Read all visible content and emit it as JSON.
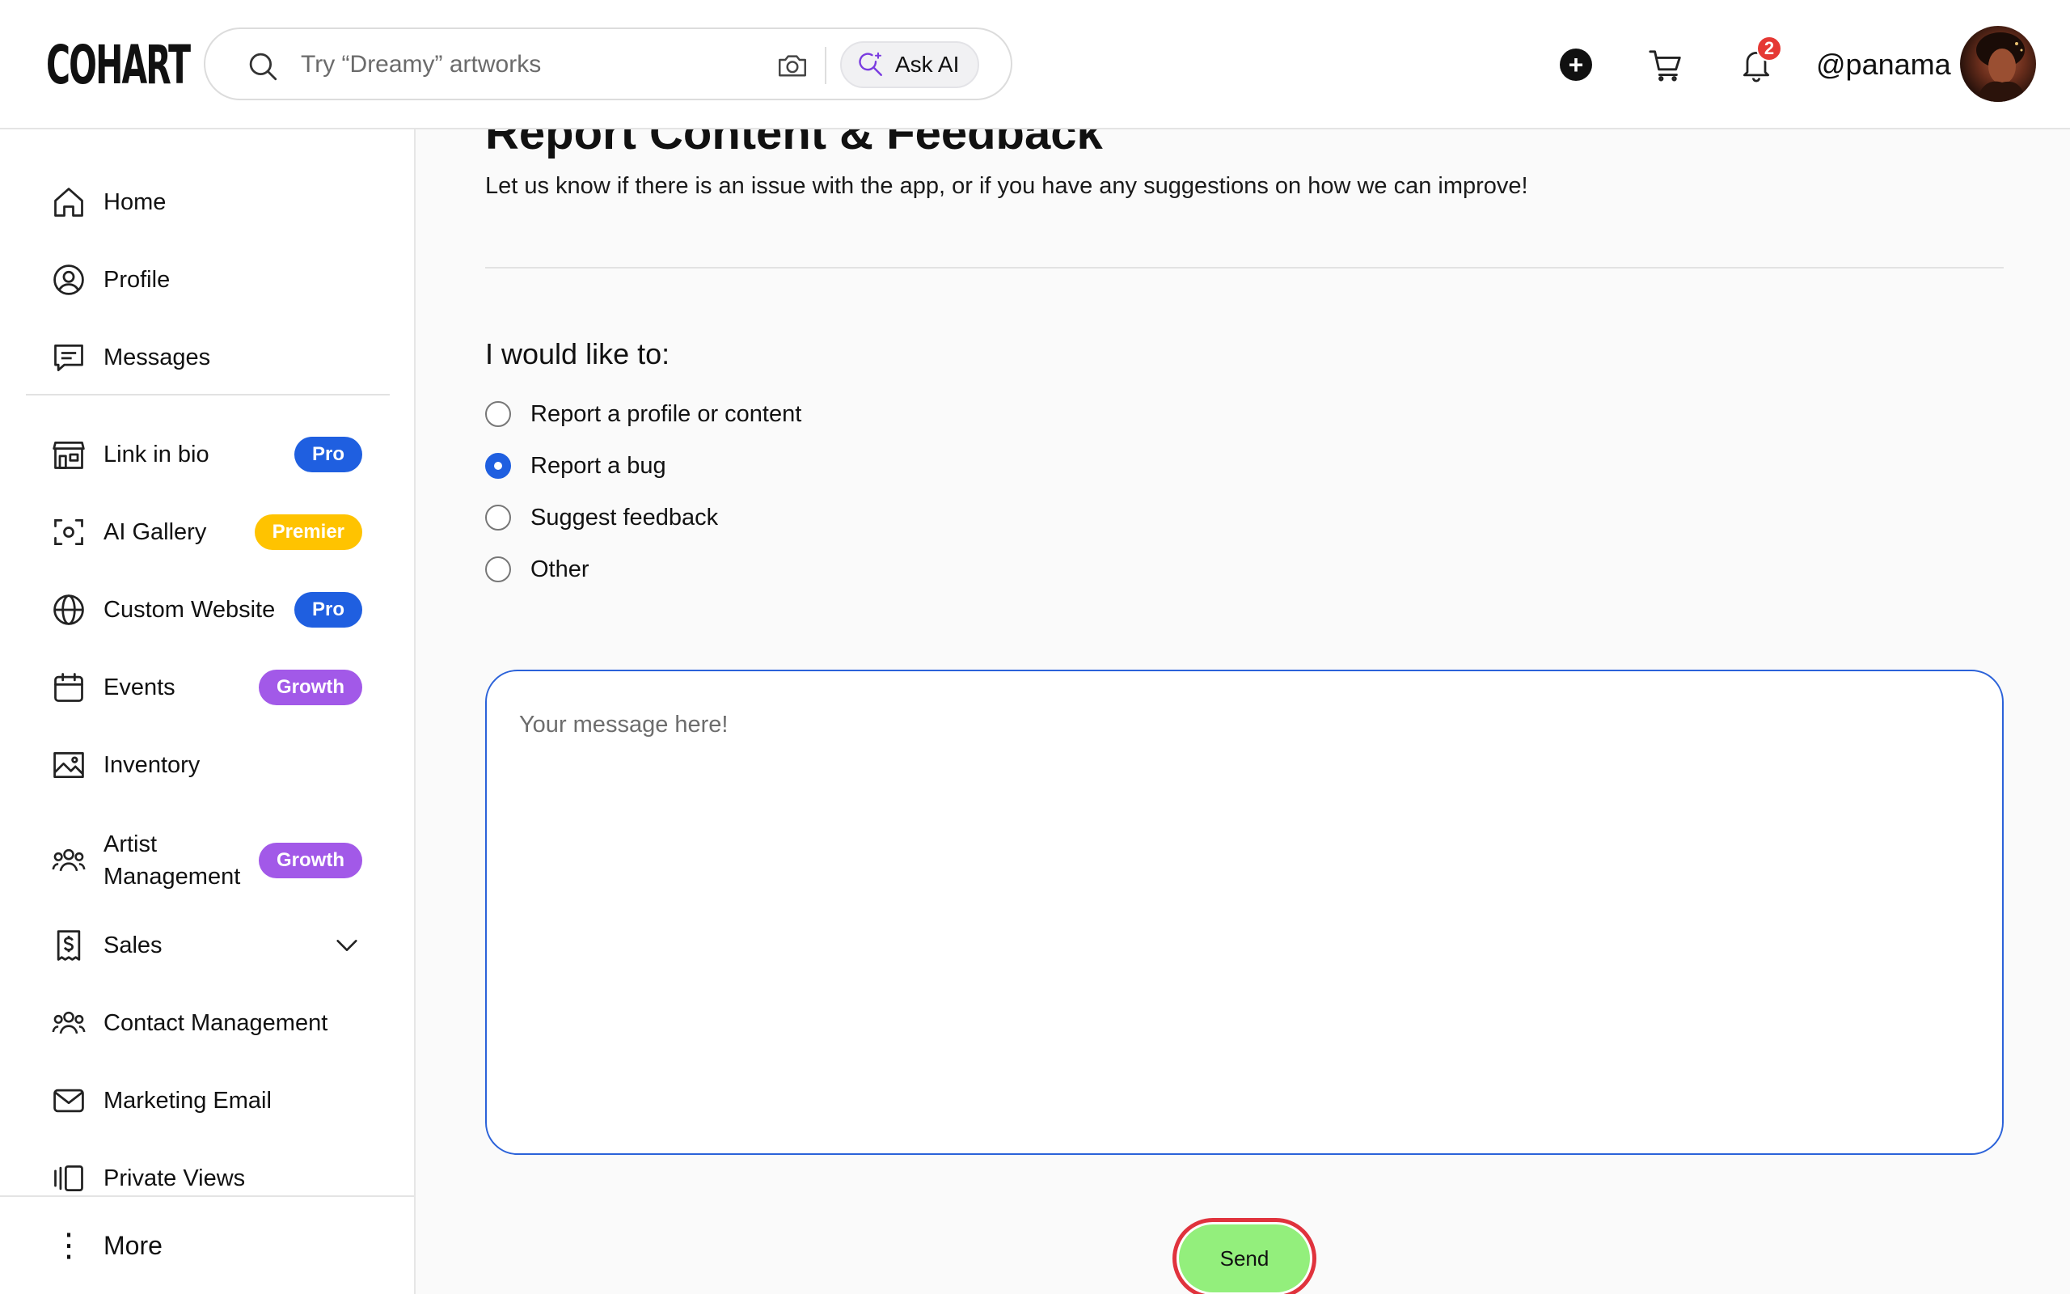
{
  "header": {
    "logo": "COHART",
    "search_placeholder": "Try “Dreamy” artworks",
    "ask_ai_label": "Ask AI",
    "notification_count": "2",
    "username": "@panama"
  },
  "sidebar": {
    "items": [
      {
        "label": "Home"
      },
      {
        "label": "Profile"
      },
      {
        "label": "Messages"
      },
      {
        "label": "Link in bio",
        "badge": "Pro"
      },
      {
        "label": "AI Gallery",
        "badge": "Premier"
      },
      {
        "label": "Custom Website",
        "badge": "Pro"
      },
      {
        "label": "Events",
        "badge": "Growth"
      },
      {
        "label": "Inventory"
      },
      {
        "label": "Artist Management",
        "badge": "Growth"
      },
      {
        "label": "Sales"
      },
      {
        "label": "Contact Management"
      },
      {
        "label": "Marketing Email"
      },
      {
        "label": "Private Views"
      }
    ],
    "more_label": "More"
  },
  "main": {
    "title": "Report Content & Feedback",
    "subtitle": "Let us know if there is an issue with the app, or if you have any suggestions on how we can improve!",
    "question": "I would like to:",
    "options": [
      {
        "label": "Report a profile or content",
        "checked": false
      },
      {
        "label": "Report a bug",
        "checked": true
      },
      {
        "label": "Suggest feedback",
        "checked": false
      },
      {
        "label": "Other",
        "checked": false
      }
    ],
    "message_placeholder": "Your message here!",
    "message_value": "",
    "send_label": "Send"
  },
  "colors": {
    "accent_blue": "#1f5fe0",
    "badge_pro": "#1f5fe0",
    "badge_premier": "#ffc300",
    "badge_growth": "#a259e8",
    "send_button": "#93ef7c",
    "send_ring": "#e0333d",
    "notification_badge": "#e53935"
  }
}
